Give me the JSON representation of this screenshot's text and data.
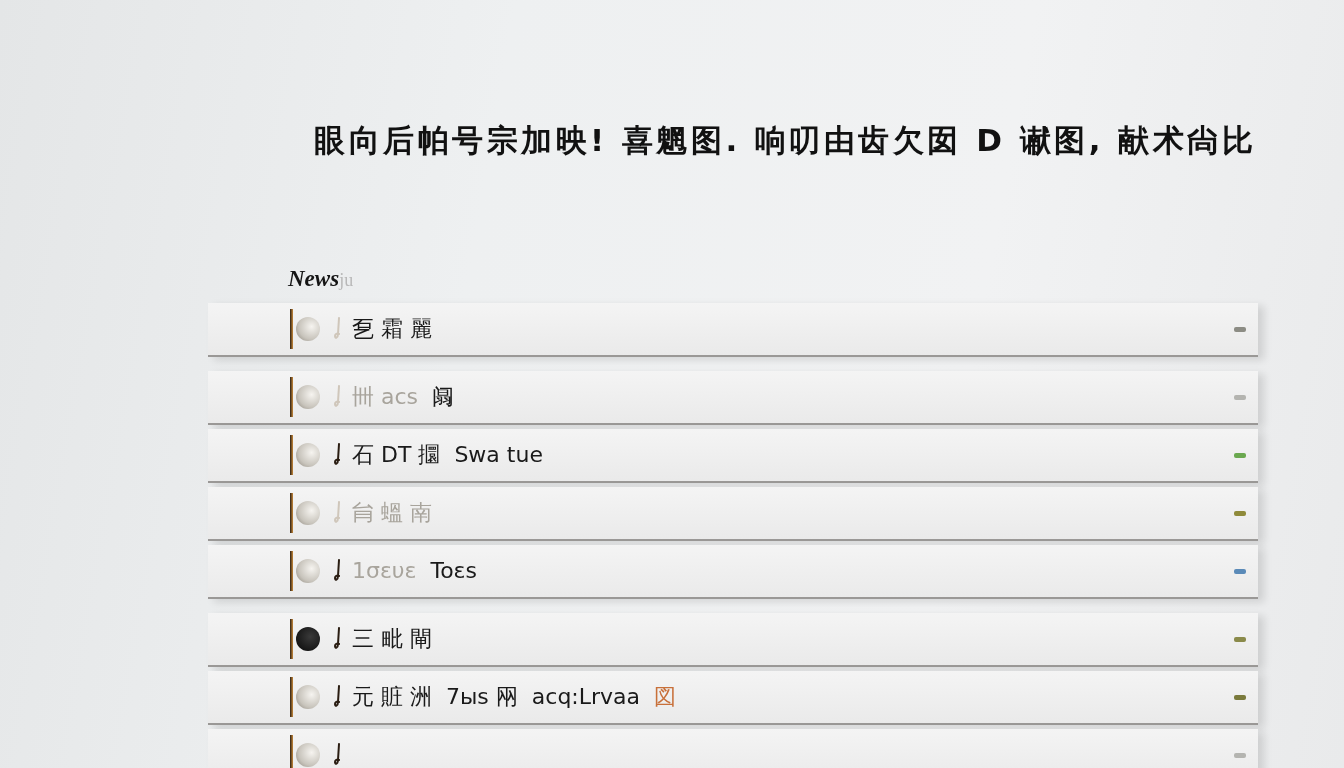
{
  "headline": "眼向后帕号宗加映! 喜魍图. 响叨由齿欠囡 D 谳图, 献术尙比",
  "section": {
    "label": "News",
    "suffix": "ju"
  },
  "groups": [
    {
      "items": [
        {
          "segments": [
            {
              "text": "乭 霜 麗",
              "kind": "plain"
            }
          ],
          "filled": false,
          "marked": false,
          "color": "#8c8c84"
        }
      ]
    },
    {
      "items": [
        {
          "segments": [
            {
              "text": "卌 acs",
              "kind": "faint"
            },
            {
              "text": "阘",
              "kind": "plain"
            }
          ],
          "filled": false,
          "marked": false,
          "color": "#b4b4b0"
        },
        {
          "segments": [
            {
              "text": "石 DT 攌",
              "kind": "plain"
            },
            {
              "text": "Swa tue",
              "kind": "plain"
            }
          ],
          "filled": false,
          "marked": true,
          "color": "#6aa84f"
        },
        {
          "segments": [
            {
              "text": "䏍 蝹 南",
              "kind": "faint"
            }
          ],
          "filled": false,
          "marked": false,
          "color": "#8f8a3a"
        },
        {
          "segments": [
            {
              "text": "1σευε",
              "kind": "faint"
            },
            {
              "text": "Toεs",
              "kind": "plain"
            }
          ],
          "filled": false,
          "marked": true,
          "color": "#5a8ab8"
        }
      ]
    },
    {
      "items": [
        {
          "segments": [
            {
              "text": "三 毗 閘",
              "kind": "plain"
            }
          ],
          "filled": true,
          "marked": true,
          "color": "#8a8a4a"
        },
        {
          "segments": [
            {
              "text": "元 賍 洲",
              "kind": "plain"
            },
            {
              "text": "7ыs 㒳",
              "kind": "plain"
            },
            {
              "text": "acq:Lrvaa",
              "kind": "plain"
            },
            {
              "text": "図",
              "kind": "accent"
            }
          ],
          "filled": false,
          "marked": true,
          "color": "#7a7a3c"
        },
        {
          "filled": false,
          "marked": true,
          "color": "#b4b4b0"
        }
      ]
    }
  ]
}
